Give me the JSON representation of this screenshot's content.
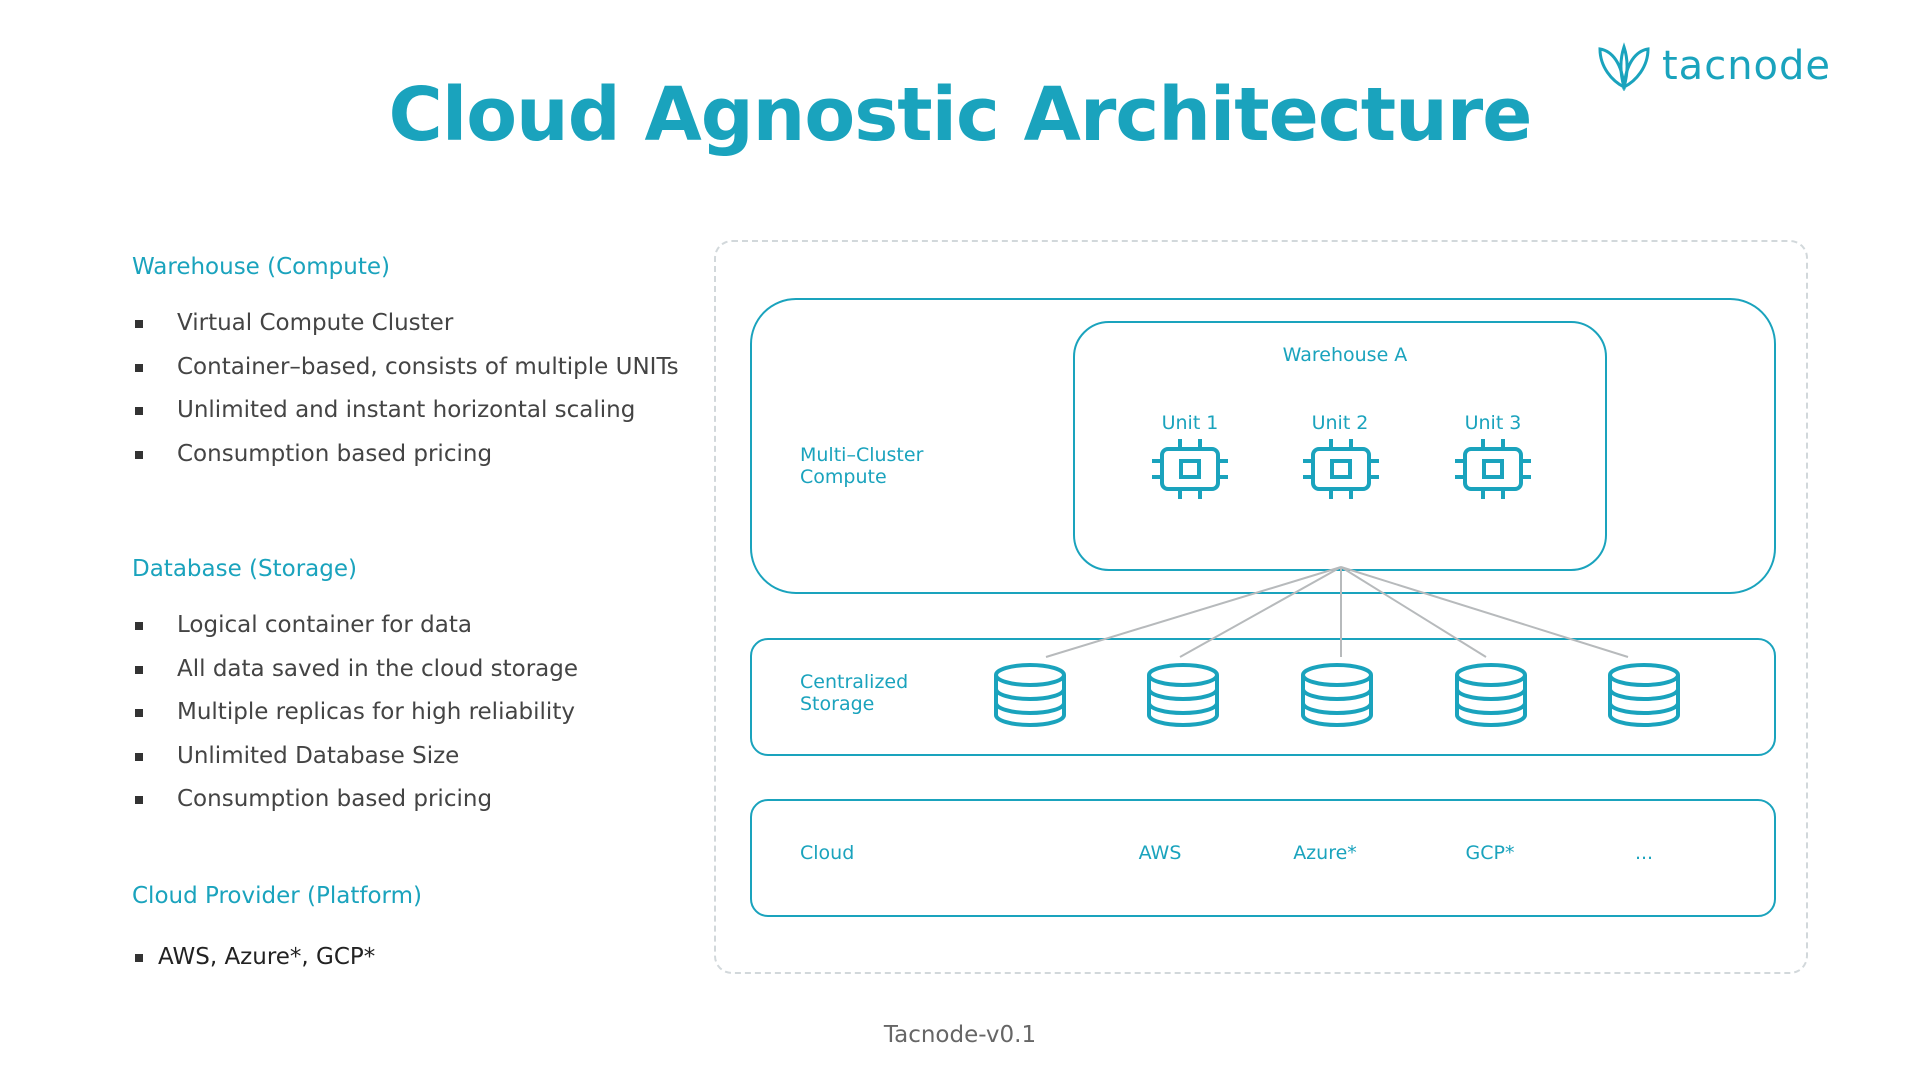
{
  "brand": {
    "name": "tacnode",
    "accent": "#1aa3bd",
    "logo_icon": "leaf-logo-icon"
  },
  "title": "Cloud Agnostic Architecture",
  "sections": {
    "warehouse": {
      "heading": "Warehouse (Compute)",
      "items": [
        "Virtual Compute Cluster",
        "Container–based, consists of multiple UNITs",
        "Unlimited and instant horizontal scaling",
        "Consumption based pricing"
      ]
    },
    "database": {
      "heading": "Database (Storage)",
      "items": [
        "Logical container for data",
        "All data saved in the cloud storage",
        "Multiple replicas for high reliability",
        "Unlimited Database Size",
        "Consumption based pricing"
      ]
    },
    "cloud": {
      "heading": "Cloud Provider (Platform)",
      "items": [
        "AWS, Azure*, GCP*"
      ]
    }
  },
  "diagram": {
    "compute_label": "Multi–Cluster\nCompute",
    "warehouse_label": "Warehouse  A",
    "units": [
      "Unit 1",
      "Unit 2",
      "Unit 3"
    ],
    "unit_icon": "chip-icon",
    "storage_label": "Centralized\nStorage",
    "storage_icon": "database-icon",
    "storage_count": 5,
    "cloud_label": "Cloud",
    "providers": [
      "AWS",
      "Azure*",
      "GCP*",
      "..."
    ]
  },
  "footer": "Tacnode-v0.1"
}
